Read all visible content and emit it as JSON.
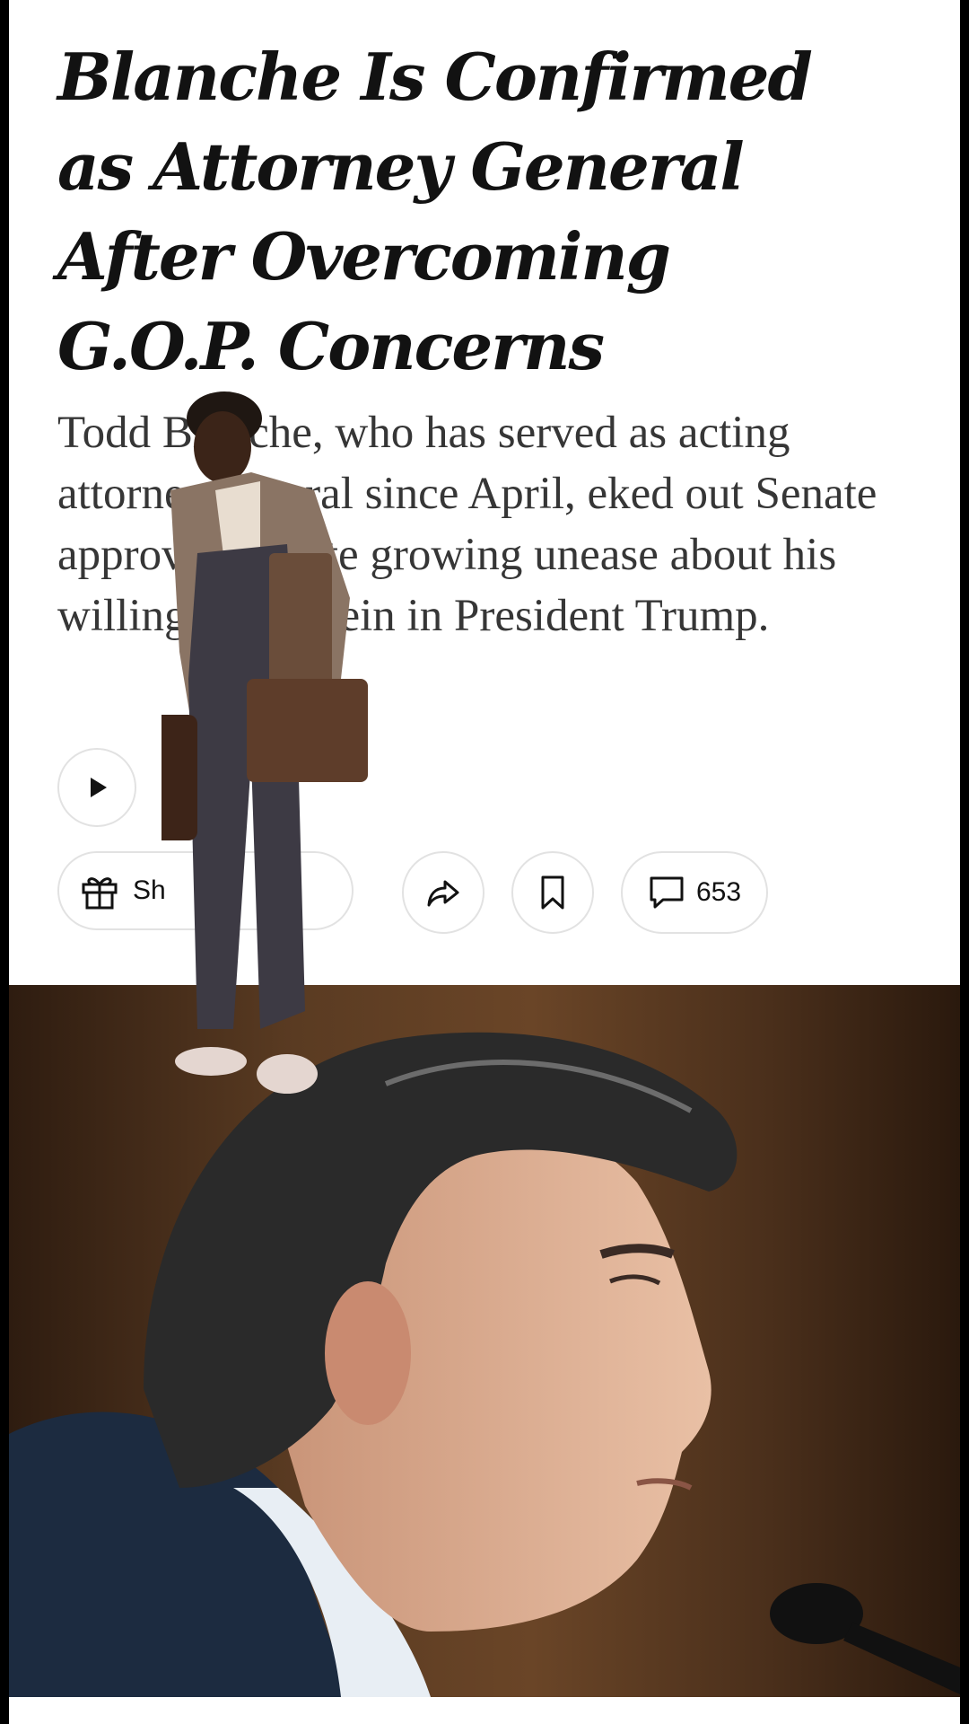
{
  "article": {
    "headline": "Blanche Is Confirmed as Attorney General After Overcoming G.O.P. Concerns",
    "summary": "Todd Blanche, who has served as acting attorney general since April, eked out Senate approval despite growing unease about his willingness to rein in President Trump."
  },
  "listen": {
    "label": "Li"
  },
  "actions": {
    "gift_label": "Sh",
    "comment_count": "653"
  },
  "icons": {
    "play": "play-icon",
    "gift": "gift-icon",
    "share": "share-icon",
    "bookmark": "bookmark-icon",
    "comment": "comment-icon"
  },
  "colors": {
    "text": "#121212",
    "summary": "#363636",
    "border": "#e2e2e2"
  }
}
